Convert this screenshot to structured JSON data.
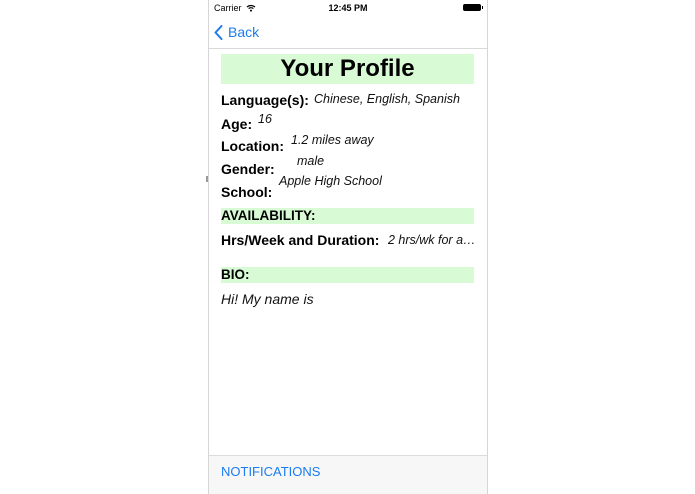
{
  "status_bar": {
    "carrier": "Carrier",
    "time": "12:45 PM"
  },
  "nav": {
    "back_label": "Back"
  },
  "profile": {
    "title": "Your Profile",
    "fields": [
      {
        "label": "Language(s):",
        "value": "Chinese, English, Spanish"
      },
      {
        "label": "Age:",
        "value": "16"
      },
      {
        "label": "Location:",
        "value": "1.2 miles away"
      },
      {
        "label": "Gender:",
        "value": "male"
      },
      {
        "label": "School:",
        "value": "Apple High School"
      }
    ],
    "availability_header": "AVAILABILITY:",
    "hours_label": "Hrs/Week and Duration:",
    "hours_value": "2 hrs/wk for a…",
    "bio_header": "BIO:",
    "bio_text": "Hi! My name is"
  },
  "bottom": {
    "notifications_label": "NOTIFICATIONS"
  },
  "colors": {
    "accent": "#1a7cf0",
    "section_bg": "#d8fbd6"
  },
  "icons": {
    "back": "chevron-left-icon",
    "wifi": "wifi-icon",
    "battery": "battery-icon"
  }
}
